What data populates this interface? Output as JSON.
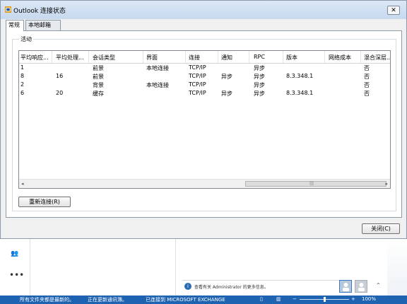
{
  "dialog": {
    "title": "Outlook 连接状态",
    "close_glyph": "✕",
    "tabs": [
      "常规",
      "本地邮箱"
    ],
    "group_label": "活动",
    "columns": [
      "平均响应...",
      "平均处理...",
      "会话类型",
      "界面",
      "连接",
      "通知",
      "RPC",
      "版本",
      "网络成本",
      "混合深层..."
    ],
    "rows": [
      [
        "1",
        "",
        "前景",
        "本地连接",
        "TCP/IP",
        "",
        "异步",
        "",
        "",
        "否"
      ],
      [
        "8",
        "16",
        "前景",
        "",
        "TCP/IP",
        "异步",
        "异步",
        "8.3.348.1",
        "",
        "否"
      ],
      [
        "2",
        "",
        "背景",
        "本地连接",
        "TCP/IP",
        "",
        "异步",
        "",
        "",
        "否"
      ],
      [
        "6",
        "20",
        "缓存",
        "",
        "TCP/IP",
        "异步",
        "异步",
        "8.3.348.1",
        "",
        "否"
      ]
    ],
    "reconnect_label": "重新连接(R)",
    "close_label": "关闭(C)",
    "scroll_left": "◂",
    "scroll_right": "▸",
    "thumb_grip": "|||"
  },
  "outlook": {
    "people_icon": "👥",
    "more_icon": "•••",
    "info_icon": "i",
    "info_text": "查看有关 Administrator 的更多信息。",
    "expand_icon": "⌃"
  },
  "statusbar": {
    "items": [
      "所有文件夹都是最新的。",
      "正在更新通讯簿。",
      "已连接到 MICROSOFT EXCHANGE"
    ],
    "zoom": "100%",
    "view_icons": [
      "▯",
      "▥"
    ],
    "minus": "−",
    "plus": "+"
  },
  "colors": {
    "accent": "#1e62b2",
    "title_bar": "#c7d9ee"
  }
}
